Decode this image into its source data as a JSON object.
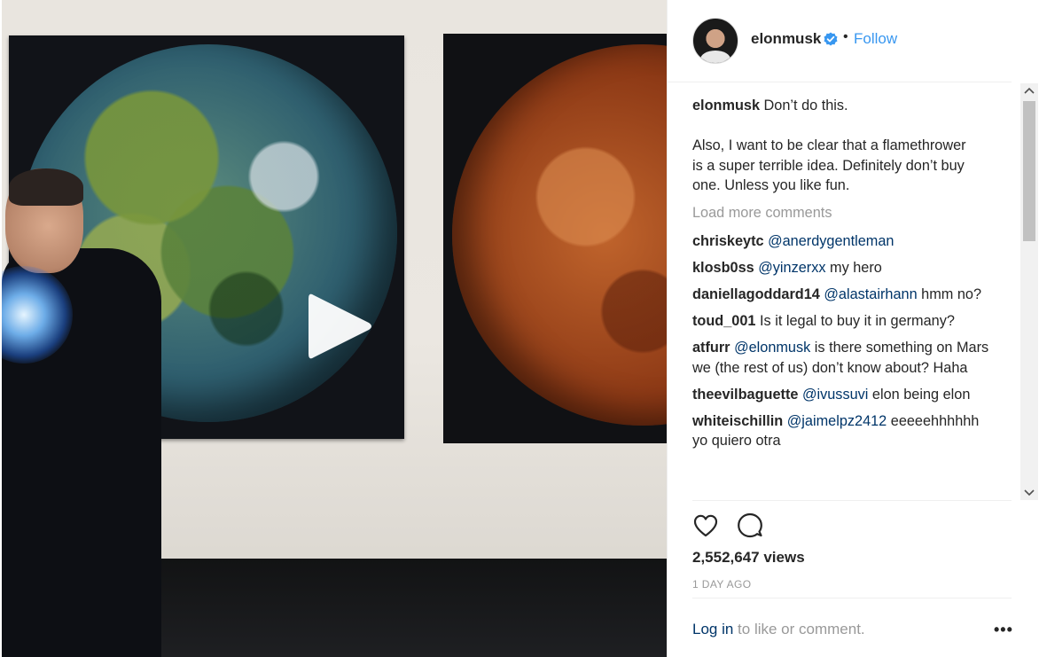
{
  "post": {
    "username": "elonmusk",
    "verified": true,
    "separator": "•",
    "follow_label": "Follow"
  },
  "caption": {
    "username": "elonmusk",
    "line1": "Don’t do this.",
    "line2": "Also, I want to be clear that a flamethrower",
    "line3": "is a super terrible idea. Definitely don’t buy",
    "line4": "one. Unless you like fun."
  },
  "load_more": "Load more comments",
  "comments": [
    {
      "user": "chriskeytc",
      "mention": "@anerdygentleman",
      "text": ""
    },
    {
      "user": "klosb0ss",
      "mention": "@yinzerxx",
      "text": " my hero"
    },
    {
      "user": "daniellagoddard14",
      "mention": "@alastairhann",
      "text": " hmm no?"
    },
    {
      "user": "toud_001",
      "mention": "",
      "text": " Is it legal to buy it in germany?"
    },
    {
      "user": "atfurr",
      "mention": "@elonmusk",
      "text": " is there something on Mars we (the rest of us) don’t know about? Haha"
    },
    {
      "user": "theevilbaguette",
      "mention": "@ivussuvi",
      "text": " elon being elon"
    },
    {
      "user": "whiteischillin",
      "mention": "@jaimelpz2412",
      "text": " eeeeehhhhhh yo quiero otra"
    }
  ],
  "stats": {
    "views": "2,552,647 views",
    "time_ago": "1 DAY AGO"
  },
  "footer": {
    "login_link": "Log in",
    "login_rest": " to like or comment.",
    "more": "•••"
  },
  "icons": {
    "play": "play-icon",
    "heart": "heart-icon",
    "comment": "comment-icon",
    "verified": "verified-badge-icon"
  },
  "colors": {
    "link": "#3897f0",
    "mention": "#003569",
    "muted": "#999999",
    "text": "#262626"
  }
}
